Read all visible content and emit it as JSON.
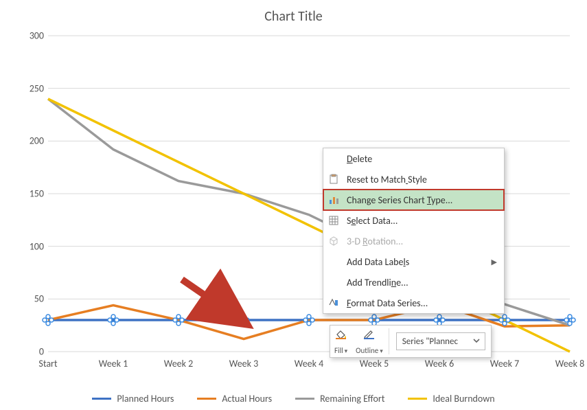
{
  "chart_data": {
    "type": "line",
    "title": "Chart Title",
    "categories": [
      "Start",
      "Week 1",
      "Week 2",
      "Week 3",
      "Week 4",
      "Week 5",
      "Week 6",
      "Week 7",
      "Week 8"
    ],
    "ylim": [
      0,
      300
    ],
    "yticks": [
      0,
      50,
      100,
      150,
      200,
      250,
      300
    ],
    "series": [
      {
        "name": "Planned Hours",
        "color": "#3e72c4",
        "values": [
          30,
          30,
          30,
          30,
          30,
          30,
          30,
          30,
          30
        ]
      },
      {
        "name": "Actual Hours",
        "color": "#e67e22",
        "values": [
          30,
          44,
          30,
          12,
          30,
          30,
          45,
          24,
          25
        ]
      },
      {
        "name": "Remaining Effort",
        "color": "#9a9a9a",
        "values": [
          240,
          192,
          162,
          150,
          130,
          100,
          55,
          45,
          25
        ]
      },
      {
        "name": "Ideal Burndown",
        "color": "#f2c200",
        "values": [
          240,
          210,
          180,
          150,
          120,
          90,
          60,
          30,
          0
        ]
      }
    ],
    "selected_series": "Planned Hours"
  },
  "context_menu": {
    "items": [
      {
        "id": "delete",
        "label": "Delete",
        "underline_idx": 0,
        "icon": "none",
        "disabled": false
      },
      {
        "id": "reset-style",
        "label": "Reset to Match Style",
        "underline_idx": 14,
        "icon": "clipboard",
        "disabled": false
      },
      {
        "id": "change-chart-type",
        "label": "Change Series Chart Type...",
        "underline_idx": 20,
        "icon": "chart",
        "disabled": false,
        "highlighted": true
      },
      {
        "id": "select-data",
        "label": "Select Data...",
        "underline_idx": 1,
        "icon": "grid",
        "disabled": false
      },
      {
        "id": "3d-rotation",
        "label": "3-D Rotation...",
        "underline_idx": 4,
        "icon": "cube",
        "disabled": true
      },
      {
        "id": "add-data-labels",
        "label": "Add Data Labels",
        "underline_idx": 13,
        "icon": "none",
        "disabled": false,
        "submenu": true
      },
      {
        "id": "add-trendline",
        "label": "Add Trendline...",
        "underline_idx": 11,
        "icon": "none",
        "disabled": false
      },
      {
        "id": "format-series",
        "label": "Format Data Series...",
        "underline_idx": 0,
        "icon": "format",
        "disabled": false
      }
    ]
  },
  "mini_toolbar": {
    "fill_label": "Fill",
    "outline_label": "Outline",
    "series_selector": "Series \"Plannec"
  },
  "legend": {
    "items": [
      "Planned Hours",
      "Actual Hours",
      "Remaining Effort",
      "Ideal Burndown"
    ]
  }
}
